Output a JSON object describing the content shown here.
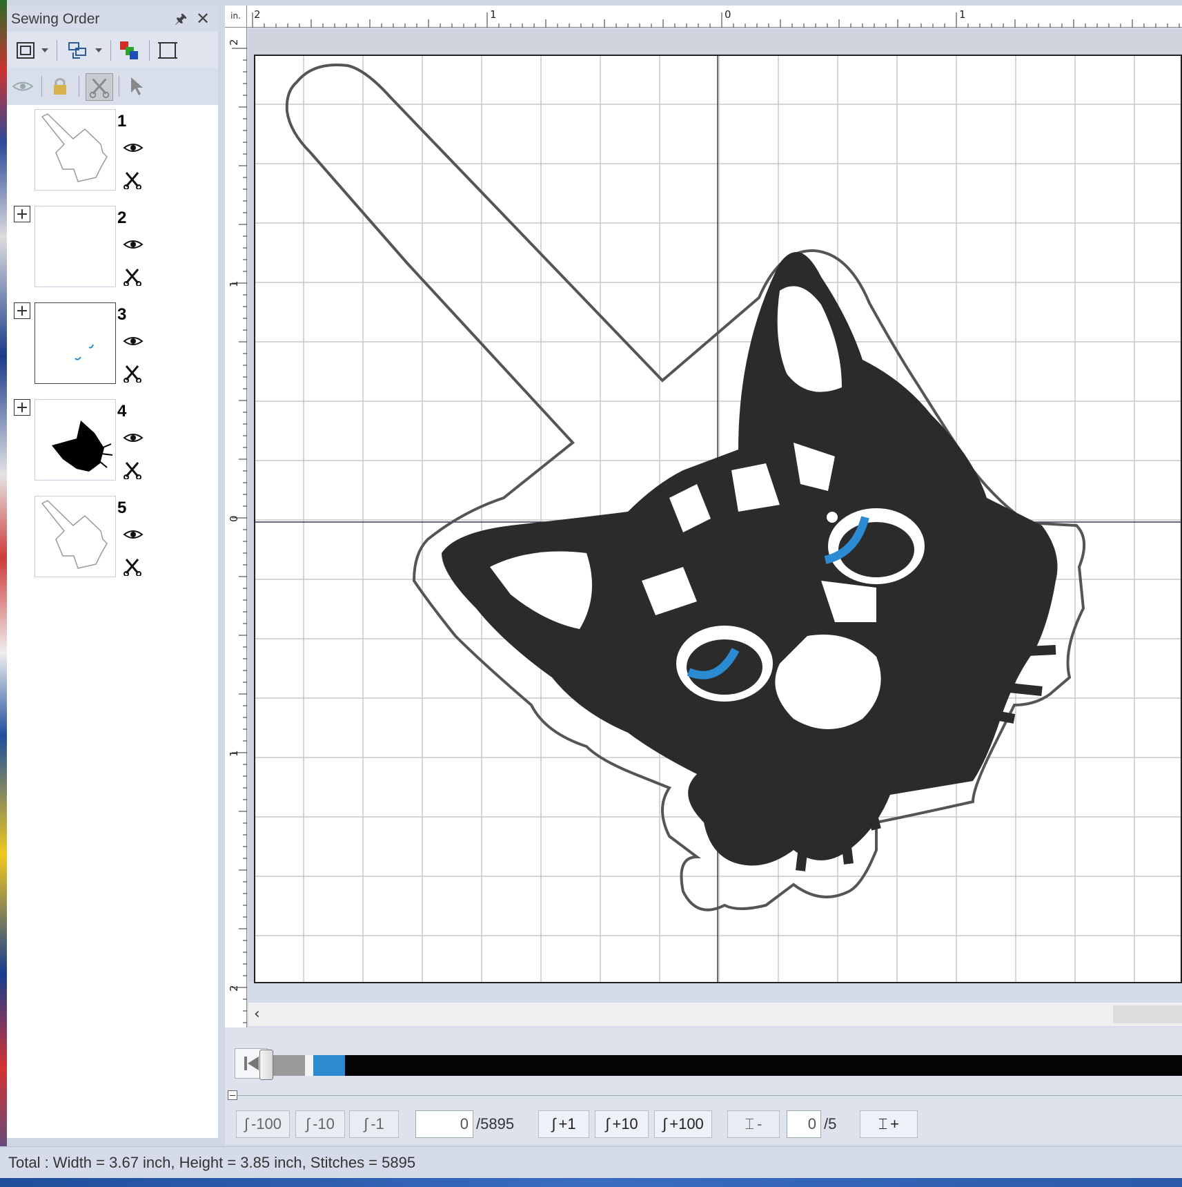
{
  "panel": {
    "title": "Sewing Order",
    "items": [
      {
        "number": "1"
      },
      {
        "number": "2"
      },
      {
        "number": "3"
      },
      {
        "number": "4"
      },
      {
        "number": "5"
      }
    ]
  },
  "ruler": {
    "unit": "in.",
    "top_labels": [
      "2",
      "1",
      "0",
      "1"
    ],
    "left_labels": [
      "2",
      "1",
      "0",
      "1",
      "2"
    ]
  },
  "colors": {
    "thread_black": "#2b2b2b",
    "thread_blue": "#2a8ad2",
    "outline": "#555555",
    "accent": "#2c8ad0"
  },
  "simulator": {
    "progress_fraction": 0.07
  },
  "nav": {
    "minus100": "-100",
    "minus10": "-10",
    "minus1": "-1",
    "stitch_value": "0",
    "stitch_total": "/5895",
    "plus1": "+1",
    "plus10": "+10",
    "plus100": "+100",
    "color_minus": "-",
    "color_value": "0",
    "color_total": "/5",
    "color_plus": "+"
  },
  "status": {
    "text": "Total : Width = 3.67 inch, Height = 3.85 inch, Stitches = 5895"
  }
}
